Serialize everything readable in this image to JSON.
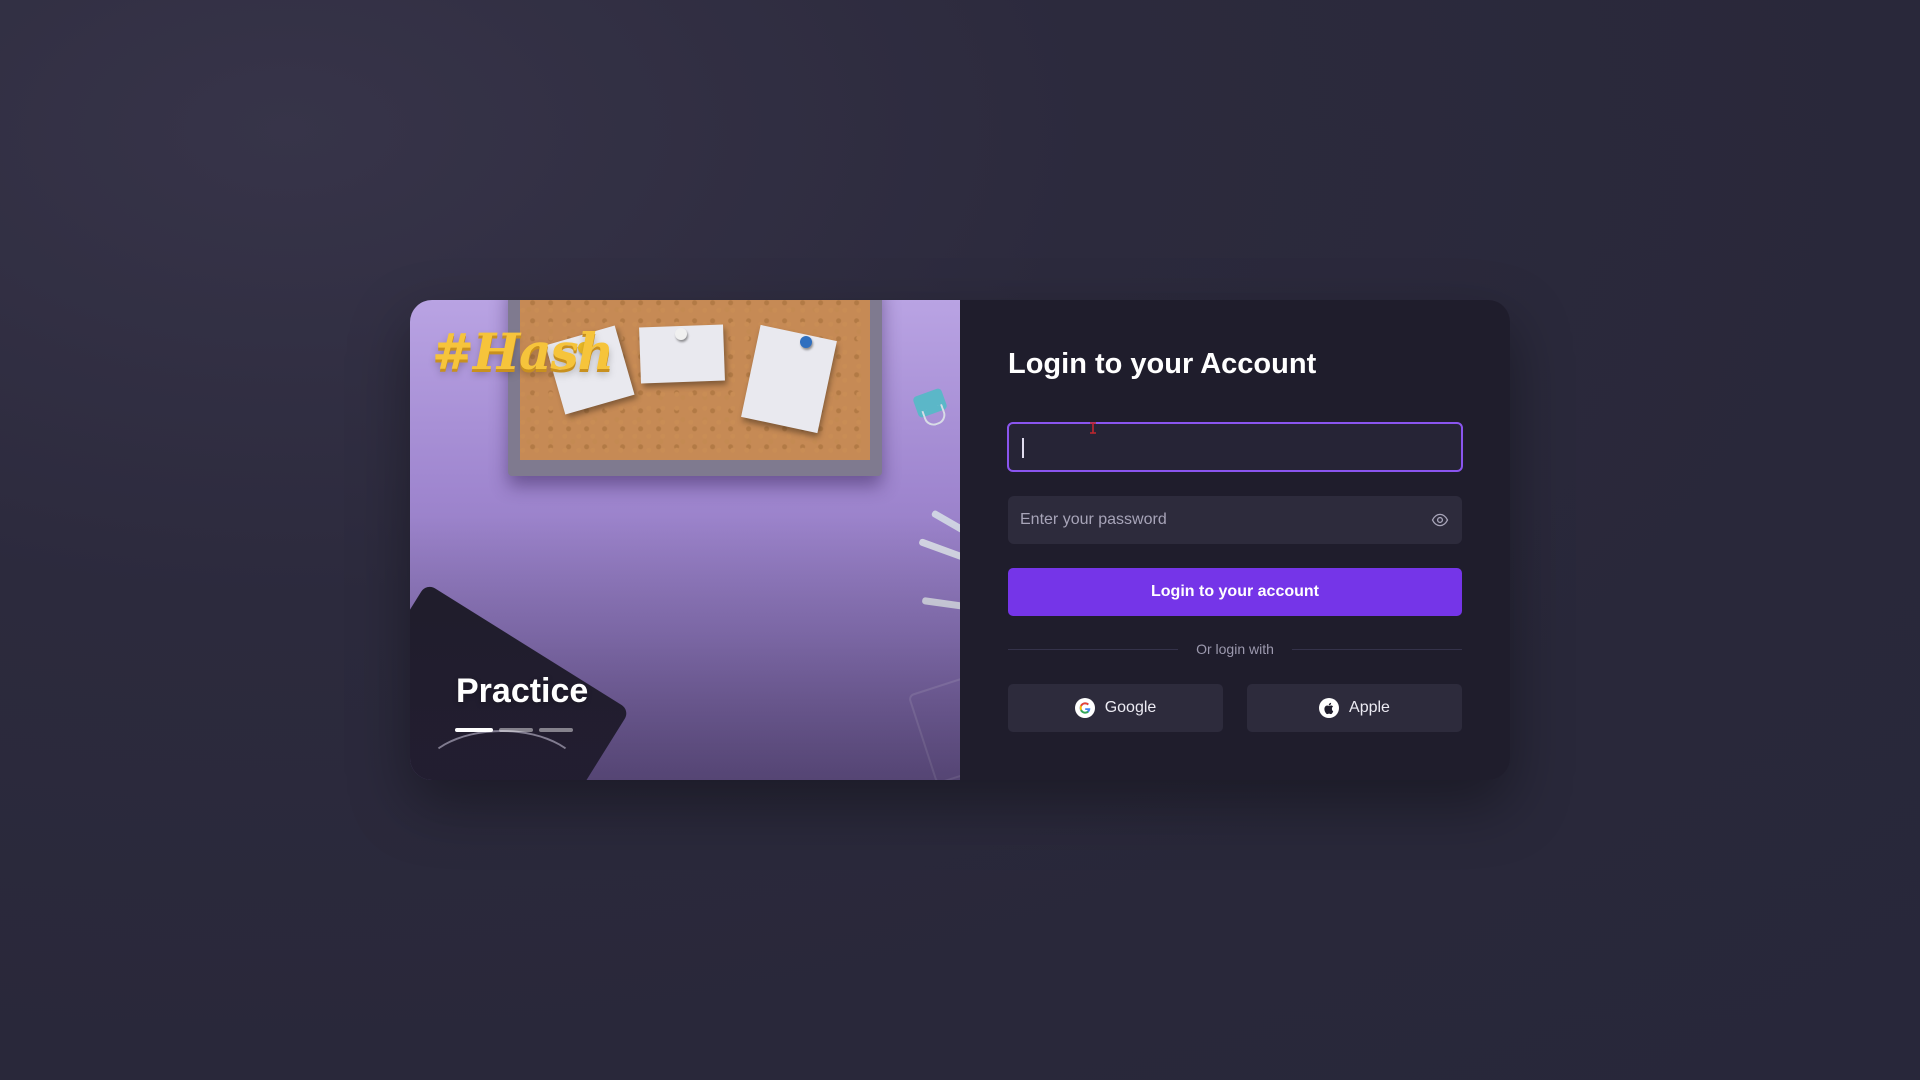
{
  "hero": {
    "brand": "#Hash",
    "slide_title": "Practice",
    "slides_total": 3,
    "active_slide": 1
  },
  "login": {
    "title": "Login to your Account",
    "email_value": "",
    "password_placeholder": "Enter your password",
    "submit_label": "Login to your account",
    "divider_text": "Or login with",
    "google_label": "Google",
    "apple_label": "Apple"
  },
  "icons": {
    "password_toggle": "eye-icon",
    "google": "google-icon",
    "apple": "apple-icon"
  },
  "colors": {
    "accent": "#7535e8",
    "focus_border": "#8a55ef",
    "panel_bg": "#1f1d2c",
    "field_bg": "#2d2b3c",
    "page_bg": "#2c2a3d"
  }
}
